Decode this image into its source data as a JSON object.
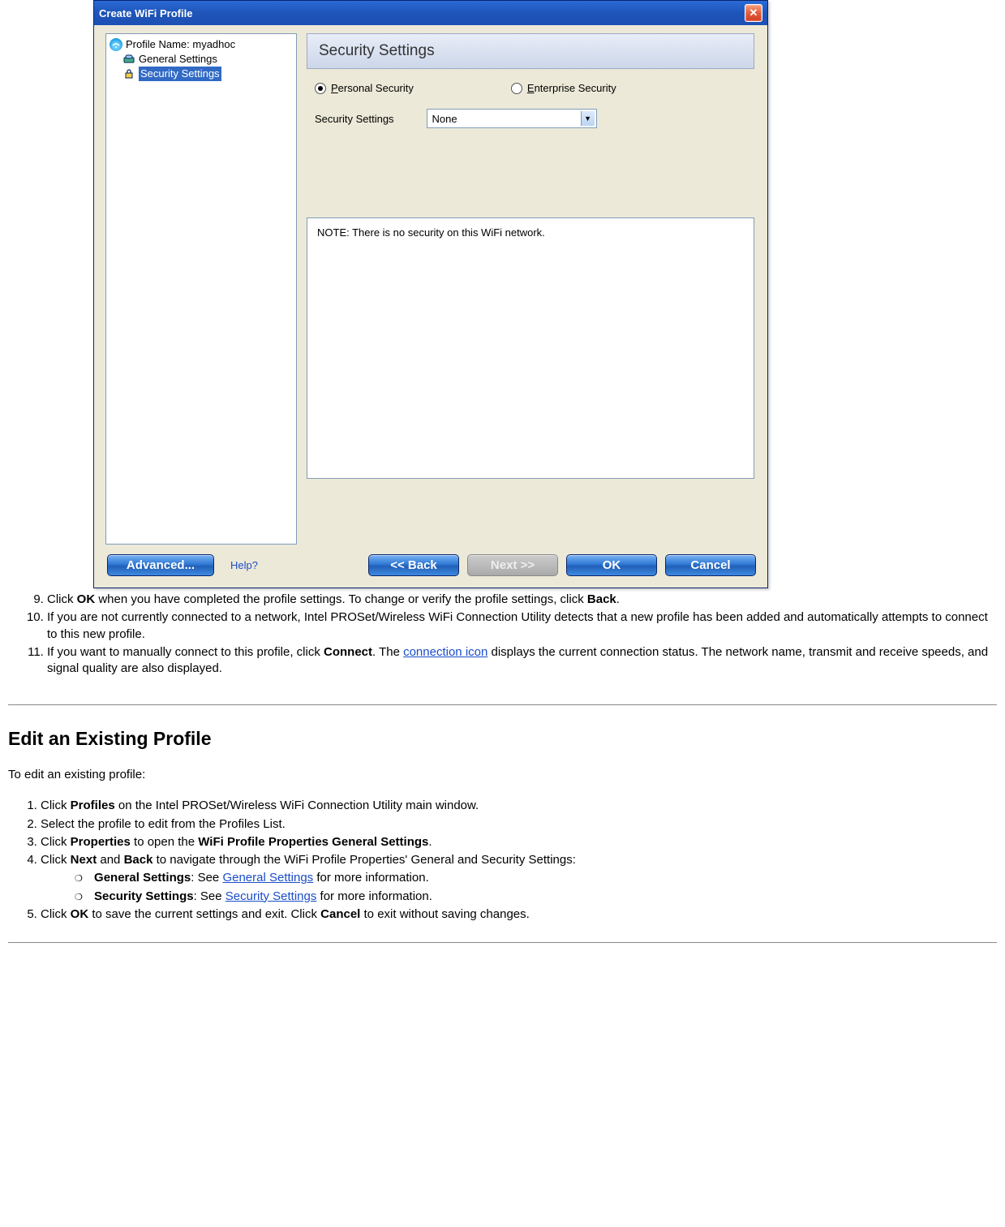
{
  "dialog": {
    "title": "Create WiFi Profile",
    "tree": {
      "root": {
        "label": "Profile Name: myadhoc"
      },
      "item_general": {
        "label": "General Settings"
      },
      "item_security": {
        "label": "Security Settings"
      }
    },
    "panel_title": "Security Settings",
    "radio_personal_prefix": "P",
    "radio_personal_rest": "ersonal Security",
    "radio_enterprise_prefix": "E",
    "radio_enterprise_rest": "nterprise Security",
    "settings_label": "Security Settings",
    "dropdown_value": "None",
    "note_text": "NOTE: There is no security on this WiFi network.",
    "buttons": {
      "advanced": "Advanced...",
      "help": "Help?",
      "back": "<< Back",
      "next": "Next >>",
      "ok": "OK",
      "cancel": "Cancel"
    }
  },
  "instr9_a": "Click ",
  "instr9_b": "OK",
  "instr9_c": " when you have completed the profile settings. To change or verify the profile settings, click ",
  "instr9_d": "Back",
  "instr9_e": ".",
  "instr10": "If you are not currently connected to a network, Intel PROSet/Wireless WiFi Connection Utility detects that a new profile has been added and automatically attempts to connect to this new profile.",
  "instr11_a": "If you want to manually connect to this profile, click ",
  "instr11_b": "Connect",
  "instr11_c": ". The ",
  "instr11_link": "connection icon",
  "instr11_d": " displays the current connection status. The network name, transmit and receive speeds, and signal quality are also displayed.",
  "section_heading": "Edit an Existing Profile",
  "section_intro": "To edit an existing profile:",
  "edit1_a": "Click ",
  "edit1_b": "Profiles",
  "edit1_c": " on the Intel PROSet/Wireless WiFi Connection Utility main window.",
  "edit2": "Select the profile to edit from the Profiles List.",
  "edit3_a": "Click ",
  "edit3_b": "Properties",
  "edit3_c": " to open the ",
  "edit3_d": "WiFi Profile Properties General Settings",
  "edit3_e": ".",
  "edit4_a": "Click ",
  "edit4_b": "Next",
  "edit4_c": " and ",
  "edit4_d": "Back",
  "edit4_e": " to navigate through the WiFi Profile Properties' General and Security Settings:",
  "edit4_sub1_a": "General Settings",
  "edit4_sub1_b": ": See ",
  "edit4_sub1_link": "General Settings",
  "edit4_sub1_c": " for more information.",
  "edit4_sub2_a": "Security Settings",
  "edit4_sub2_b": ": See ",
  "edit4_sub2_link": "Security Settings",
  "edit4_sub2_c": " for more information.",
  "edit5_a": "Click ",
  "edit5_b": "OK",
  "edit5_c": " to save the current settings and exit. Click ",
  "edit5_d": "Cancel",
  "edit5_e": " to exit without saving changes."
}
